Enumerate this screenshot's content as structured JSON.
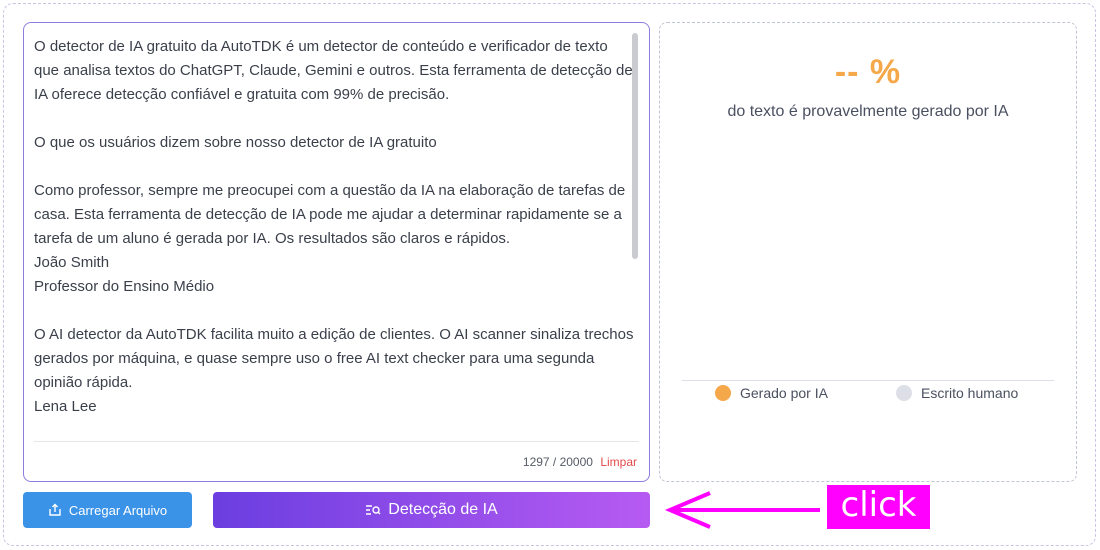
{
  "editor": {
    "text": "O detector de IA gratuito da AutoTDK é um detector de conteúdo e verificador de texto que analisa textos do ChatGPT, Claude, Gemini e outros. Esta ferramenta de detecção de IA oferece detecção confiável e gratuita com 99% de precisão.\n\nO que os usuários dizem sobre nosso detector de IA gratuito\n\nComo professor, sempre me preocupei com a questão da IA na elaboração de tarefas de casa. Esta ferramenta de detecção de IA pode me ajudar a determinar rapidamente se a tarefa de um aluno é gerada por IA. Os resultados são claros e rápidos.\nJoão Smith\nProfessor do Ensino Médio\n\nO AI detector da AutoTDK facilita muito a edição de clientes. O AI scanner sinaliza trechos gerados por máquina, e quase sempre uso o free AI text checker para uma segunda opinião rápida.\nLena Lee",
    "char_count": "1297 / 20000",
    "clear_label": "Limpar"
  },
  "result": {
    "percent": "-- %",
    "subtitle": "do texto é provavelmente gerado por IA",
    "legend": [
      {
        "label": "Gerado por IA",
        "color": "#f5a84a"
      },
      {
        "label": "Escrito humano",
        "color": "#dcdfe6"
      }
    ]
  },
  "buttons": {
    "upload_label": "Carregar Arquivo",
    "upload_icon": "upload-icon",
    "detect_label": "Detecção de IA",
    "detect_icon": "scan-search-icon"
  },
  "annotation": {
    "click_label": "click",
    "color": "#ff00ff"
  }
}
